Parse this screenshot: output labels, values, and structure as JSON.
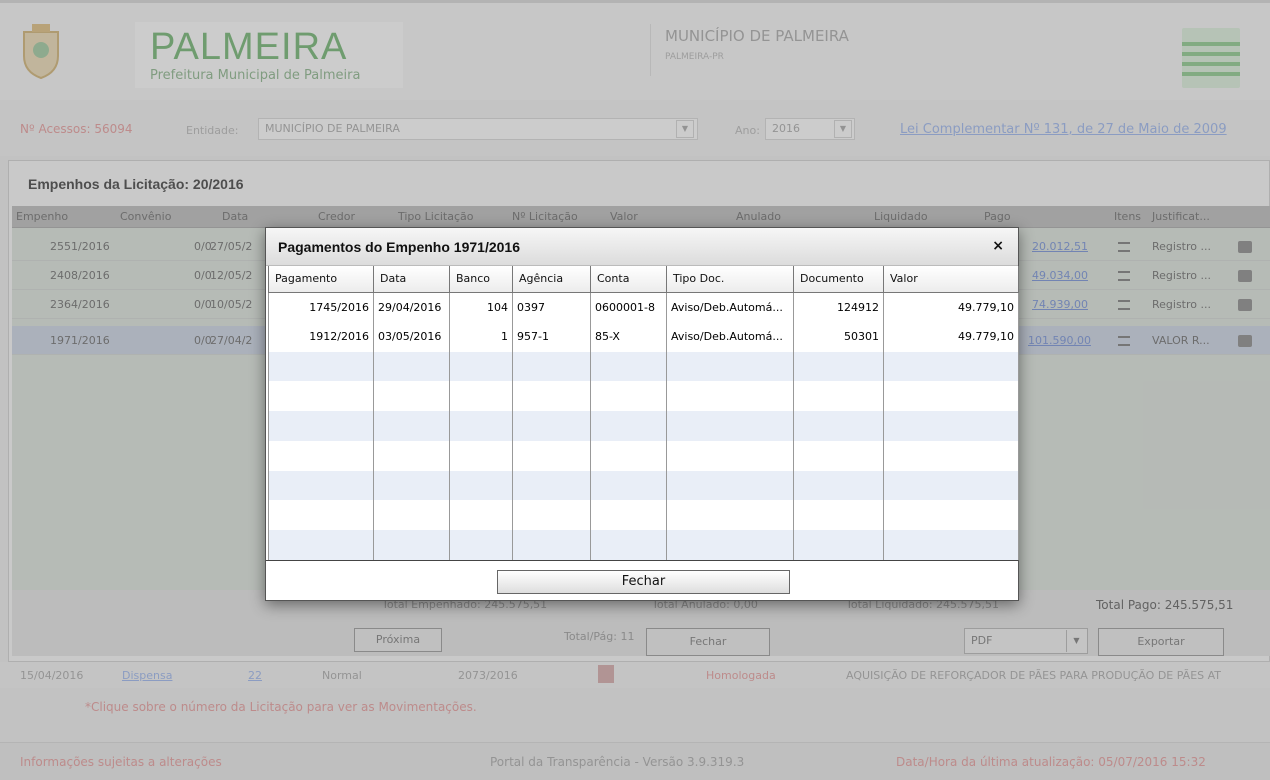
{
  "header": {
    "brand": "PALMEIRA",
    "brand_sub": "Prefeitura Municipal de Palmeira",
    "municipio": "MUNICÍPIO DE PALMEIRA",
    "municipio_sub": "PALMEIRA-PR"
  },
  "filters": {
    "acessos": "Nº Acessos: 56094",
    "entidade_label": "Entidade:",
    "entidade_value": "MUNICÍPIO DE PALMEIRA",
    "ano_label": "Ano:",
    "ano_value": "2016",
    "lei_link": "Lei Complementar Nº 131, de 27 de Maio de 2009"
  },
  "window": {
    "title": "Empenhos da Licitação: 20/2016",
    "columns": [
      "Empenho",
      "Convênio",
      "Data",
      "Credor",
      "Tipo Licitação",
      "Nº Licitação",
      "Valor",
      "Anulado",
      "Liquidado",
      "Pago",
      "Itens",
      "Justificat..."
    ],
    "rows": [
      {
        "empenho": "2551/2016",
        "convenio": "0/0",
        "data": "27/05/2",
        "pago": "20.012,51",
        "justificativa": "Registro ..."
      },
      {
        "empenho": "2408/2016",
        "convenio": "0/0",
        "data": "12/05/2",
        "pago": "49.034,00",
        "justificativa": "Registro ..."
      },
      {
        "empenho": "2364/2016",
        "convenio": "0/0",
        "data": "10/05/2",
        "pago": "74.939,00",
        "justificativa": "Registro ..."
      },
      {
        "empenho": "1971/2016",
        "convenio": "0/0",
        "data": "27/04/2",
        "pago": "101.590,00",
        "justificativa": "VALOR R..."
      }
    ],
    "total_empenhado": "Total Empenhado:  245.575,51",
    "total_anulado": "Total Anulado:  0,00",
    "total_liquidado": "Total Liquidado:  245.575,51",
    "total_pago": "Total Pago:  245.575,51",
    "proxima": "Próxima",
    "total_pag": "Total/Pág: 11",
    "fechar": "Fechar",
    "export_format": "PDF",
    "exportar": "Exportar"
  },
  "licitacao_row": {
    "data": "15/04/2016",
    "modalidade": "Dispensa",
    "numero": "22",
    "tipo": "Normal",
    "processo": "2073/2016",
    "situacao": "Homologada",
    "objeto": "AQUISIÇÃO DE REFORÇADOR DE PÃES PARA PRODUÇÃO DE PÃES AT"
  },
  "hint": "*Clique sobre o número da Licitação para ver as Movimentações.",
  "footer": {
    "left": "Informações sujeitas a alterações",
    "center": "Portal da Transparência - Versão 3.9.319.3",
    "right": "Data/Hora da última atualização: 05/07/2016 15:32"
  },
  "modal": {
    "title": "Pagamentos do Empenho 1971/2016",
    "close": "×",
    "columns": [
      "Pagamento",
      "Data",
      "Banco",
      "Agência",
      "Conta",
      "Tipo Doc.",
      "Documento",
      "Valor"
    ],
    "rows": [
      [
        "1745/2016",
        "29/04/2016",
        "104",
        "0397",
        "0600001-8",
        "Aviso/Deb.Automá...",
        "124912",
        "49.779,10"
      ],
      [
        "1912/2016",
        "03/05/2016",
        "1",
        "957-1",
        "85-X",
        "Aviso/Deb.Automá...",
        "50301",
        "49.779,10"
      ]
    ],
    "fechar": "Fechar"
  },
  "colors": {
    "accent": "#5aa85a",
    "link": "#5f7fcf",
    "selected_row": "#c2ccdd",
    "alt_row": "#e9eef7"
  }
}
